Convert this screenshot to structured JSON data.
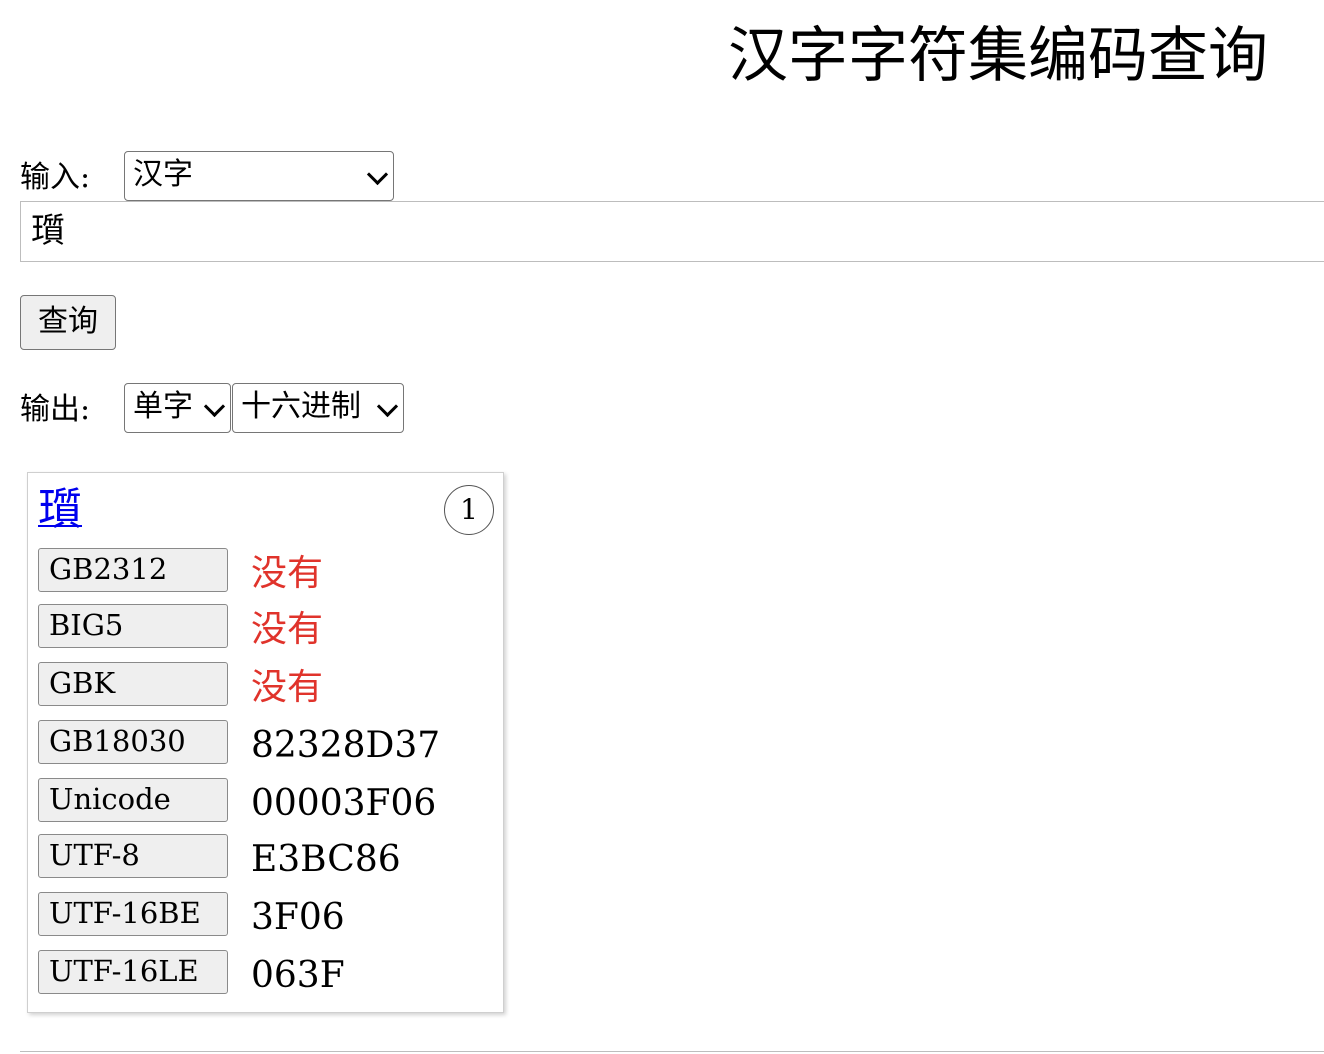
{
  "page": {
    "title": "汉字字符集编码查询"
  },
  "input_section": {
    "label": "输入:",
    "type_select_value": "汉字",
    "text_value": "瓆",
    "query_button_label": "查询"
  },
  "output_section": {
    "label": "输出:",
    "mode_select_value": "单字",
    "base_select_value": "十六进制"
  },
  "result_card": {
    "character": "瓆",
    "index_badge": "1",
    "missing_color": "#e0332b",
    "link_color": "#0000ee",
    "rows": [
      {
        "encoding": "GB2312",
        "value": "没有",
        "missing": true
      },
      {
        "encoding": "BIG5",
        "value": "没有",
        "missing": true
      },
      {
        "encoding": "GBK",
        "value": "没有",
        "missing": true
      },
      {
        "encoding": "GB18030",
        "value": "82328D37",
        "missing": false
      },
      {
        "encoding": "Unicode",
        "value": "00003F06",
        "missing": false
      },
      {
        "encoding": "UTF-8",
        "value": "E3BC86",
        "missing": false
      },
      {
        "encoding": "UTF-16BE",
        "value": "3F06",
        "missing": false
      },
      {
        "encoding": "UTF-16LE",
        "value": "063F",
        "missing": false
      }
    ]
  }
}
